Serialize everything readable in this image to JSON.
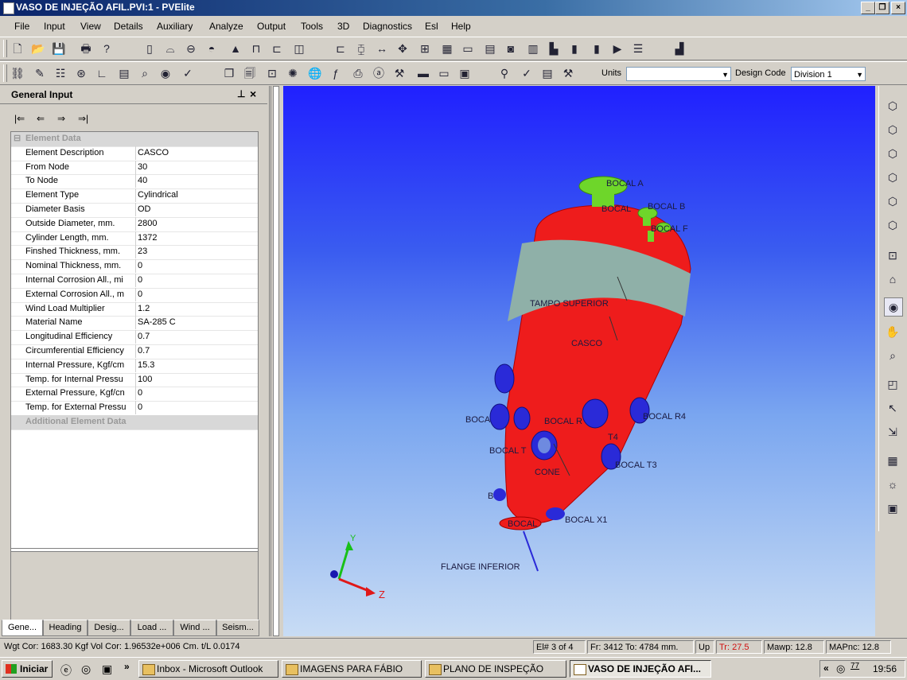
{
  "window": {
    "title": "VASO DE INJEÇÃO AFIL.PVI:1 - PVElite",
    "controls": [
      "_",
      "❐",
      "×"
    ]
  },
  "menu": [
    "File",
    "Input",
    "View",
    "Details",
    "Auxiliary",
    "Analyze",
    "Output",
    "Tools",
    "3D",
    "Diagnostics",
    "Esl",
    "Help"
  ],
  "toolbar2": {
    "units_label": "Units",
    "units_value": "",
    "design_code_label": "Design Code",
    "design_code_value": "Division 1"
  },
  "panel": {
    "title": "General Input",
    "pin": "⊥",
    "close": "×",
    "nav": [
      "|⇐",
      "⇐",
      "⇒",
      "⇒|"
    ],
    "section": "Element Data",
    "rows": [
      {
        "k": "Element Description",
        "v": "CASCO"
      },
      {
        "k": "From Node",
        "v": "30"
      },
      {
        "k": "To Node",
        "v": "40"
      },
      {
        "k": "Element Type",
        "v": "Cylindrical"
      },
      {
        "k": "Diameter Basis",
        "v": "OD"
      },
      {
        "k": "Outside Diameter, mm.",
        "v": "2800"
      },
      {
        "k": "Cylinder Length, mm.",
        "v": "1372"
      },
      {
        "k": "Finshed Thickness, mm.",
        "v": "23"
      },
      {
        "k": "Nominal Thickness, mm.",
        "v": "0"
      },
      {
        "k": "Internal Corrosion All., mi",
        "v": "0"
      },
      {
        "k": "External Corrosion All., m",
        "v": "0"
      },
      {
        "k": "Wind Load Multiplier",
        "v": "1.2"
      },
      {
        "k": "Material Name",
        "v": "SA-285 C"
      },
      {
        "k": "Longitudinal Efficiency",
        "v": "0.7"
      },
      {
        "k": "Circumferential Efficiency",
        "v": "0.7"
      },
      {
        "k": "Internal Pressure, Kgf/cm",
        "v": "15.3"
      },
      {
        "k": "Temp. for Internal Pressu",
        "v": "100"
      },
      {
        "k": "External Pressure, Kgf/cn",
        "v": "0"
      },
      {
        "k": "Temp. for External Pressu",
        "v": "0"
      }
    ],
    "additional": "Additional Element Data",
    "tabs": [
      "Gene...",
      "Heading",
      "Desig...",
      "Load ...",
      "Wind ...",
      "Seism..."
    ]
  },
  "model_labels": {
    "bocal_a": "BOCAL A",
    "bocal_b": "BOCAL B",
    "bocal_b_overlap": "BOCAL",
    "bocal_f": "BOCAL F",
    "tampo": "TAMPO SUPERIOR",
    "casco": "CASCO",
    "bocal_r4": "BOCAL R4",
    "bocal_left": "BOCA",
    "bocal_mid": "BOCAL R",
    "t4": "T4",
    "bocal_t_left": "BOCAL T",
    "bocal_t3": "BOCAL T3",
    "cone": "CONE",
    "b_small": "B",
    "bocal_x1": "BOCAL X1",
    "bocal_bottom": "BOCAL",
    "flange": "FLANGE INFERIOR",
    "axis_y": "Y",
    "axis_z": "Z"
  },
  "status": {
    "weights": "Wgt Cor: 1683.30 Kgf  Vol Cor: 1.96532e+006 Cm.  t/L 0.0174",
    "element": "El# 3 of 4",
    "from_to": "Fr: 3412 To: 4784 mm.",
    "up": "Up",
    "tr": "Tr: 27.5",
    "mawp": "Mawp: 12.8",
    "mapnc": "MAPnc: 12.8"
  },
  "taskbar": {
    "start": "Iniciar",
    "more": "»",
    "tasks": [
      "Inbox - Microsoft Outlook",
      "IMAGENS PARA FÁBIO",
      "PLANO DE INSPEÇÃO",
      "VASO DE INJEÇÃO AFI..."
    ],
    "tray_arrow": "«",
    "tray_num": "77",
    "clock": "19:56"
  },
  "colors": {
    "vessel_red": "#ee1c1c",
    "band": "#8fb0a8",
    "nozzle_green": "#6ed62a",
    "nozzle_blue": "#2a2ad8"
  }
}
